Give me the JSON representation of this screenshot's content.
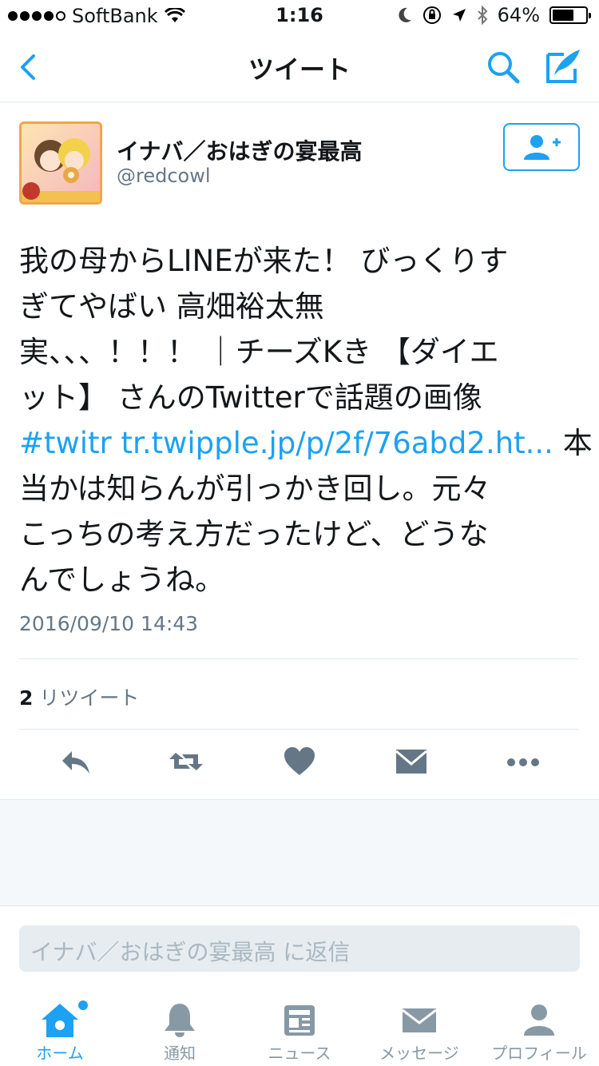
{
  "status_bar": {
    "carrier": "SoftBank",
    "time": "1:16",
    "battery": "64%",
    "battery_level": 0.64
  },
  "nav": {
    "title": "ツイート"
  },
  "tweet": {
    "display_name": "イナバ／おはぎの宴最高",
    "handle": "@redcowl",
    "text_lines": [
      "我の母からLINEが来た！ びっくりす",
      "ぎてやばい 高畑裕太無",
      "実、、、！！！ ｜チーズKき 【ダイエ",
      "ット】 さんのTwitterで話題の画像",
      "",
      "当かは知らんが引っかき回し。元々",
      "こっちの考え方だったけど、どうな",
      "んでしょうね。"
    ],
    "hashtag": "#twitr",
    "link": "tr.twipple.jp/p/2f/76abd2.ht...",
    "link_tail": "本",
    "timestamp": "2016/09/10 14:43",
    "retweet_count": "2",
    "retweet_label": "リツイート"
  },
  "reply": {
    "placeholder": "イナバ／おはぎの宴最高 に返信"
  },
  "tabs": [
    {
      "label": "ホーム",
      "icon": "home-icon",
      "active": true
    },
    {
      "label": "通知",
      "icon": "bell-icon",
      "active": false
    },
    {
      "label": "ニュース",
      "icon": "news-icon",
      "active": false
    },
    {
      "label": "メッセージ",
      "icon": "mail-icon",
      "active": false
    },
    {
      "label": "プロフィール",
      "icon": "profile-icon",
      "active": false
    }
  ],
  "colors": {
    "accent": "#1da1f2",
    "icon_gray": "#657786",
    "text_muted": "#657786"
  }
}
